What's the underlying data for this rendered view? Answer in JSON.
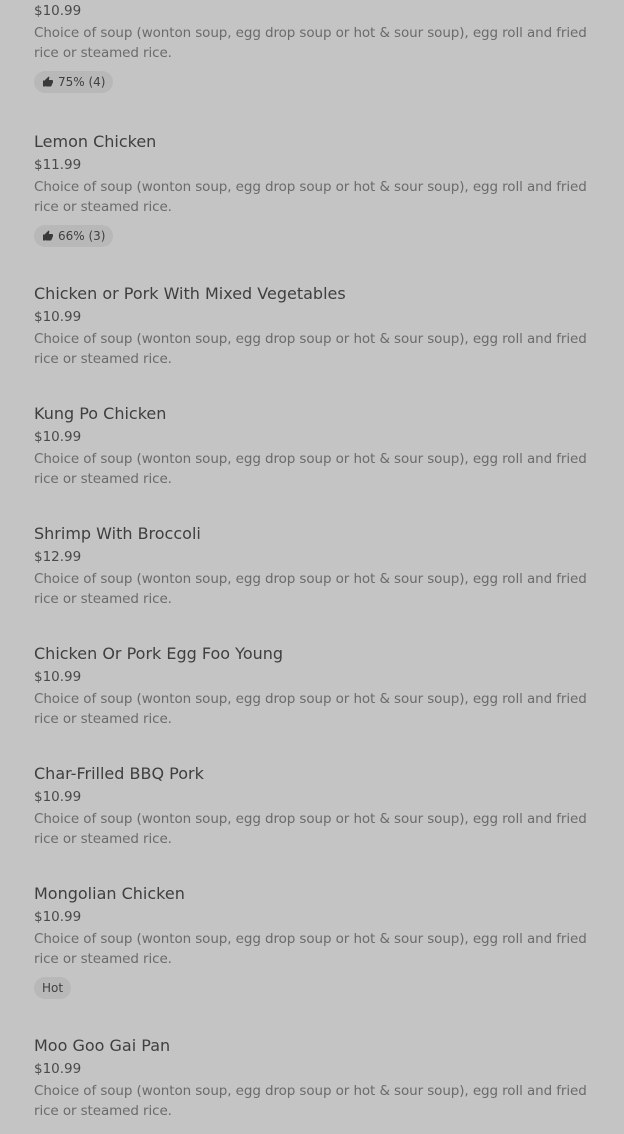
{
  "menu": {
    "items": [
      {
        "name": "",
        "price": "$10.99",
        "description": "Choice of soup (wonton soup, egg drop soup or hot & sour soup), egg roll and fried rice or steamed rice.",
        "rating": "75% (4)"
      },
      {
        "name": "Lemon Chicken",
        "price": "$11.99",
        "description": "Choice of soup (wonton soup, egg drop soup or hot & sour soup), egg roll and fried rice or steamed rice.",
        "rating": "66% (3)"
      },
      {
        "name": "Chicken or Pork With Mixed Vegetables",
        "price": "$10.99",
        "description": "Choice of soup (wonton soup, egg drop soup or hot & sour soup), egg roll and fried rice or steamed rice."
      },
      {
        "name": "Kung Po Chicken",
        "price": "$10.99",
        "description": "Choice of soup (wonton soup, egg drop soup or hot & sour soup), egg roll and fried rice or steamed rice."
      },
      {
        "name": "Shrimp With Broccoli",
        "price": "$12.99",
        "description": "Choice of soup (wonton soup, egg drop soup or hot & sour soup), egg roll and fried rice or steamed rice."
      },
      {
        "name": "Chicken Or Pork Egg Foo Young",
        "price": "$10.99",
        "description": "Choice of soup (wonton soup, egg drop soup or hot & sour soup), egg roll and fried rice or steamed rice."
      },
      {
        "name": "Char-Frilled BBQ Pork",
        "price": "$10.99",
        "description": "Choice of soup (wonton soup, egg drop soup or hot & sour soup), egg roll and fried rice or steamed rice."
      },
      {
        "name": "Mongolian Chicken",
        "price": "$10.99",
        "description": "Choice of soup (wonton soup, egg drop soup or hot & sour soup), egg roll and fried rice or steamed rice.",
        "tag": "Hot"
      },
      {
        "name": "Moo Goo Gai Pan",
        "price": "$10.99",
        "description": "Choice of soup (wonton soup, egg drop soup or hot & sour soup), egg roll and fried rice or steamed rice."
      }
    ]
  }
}
